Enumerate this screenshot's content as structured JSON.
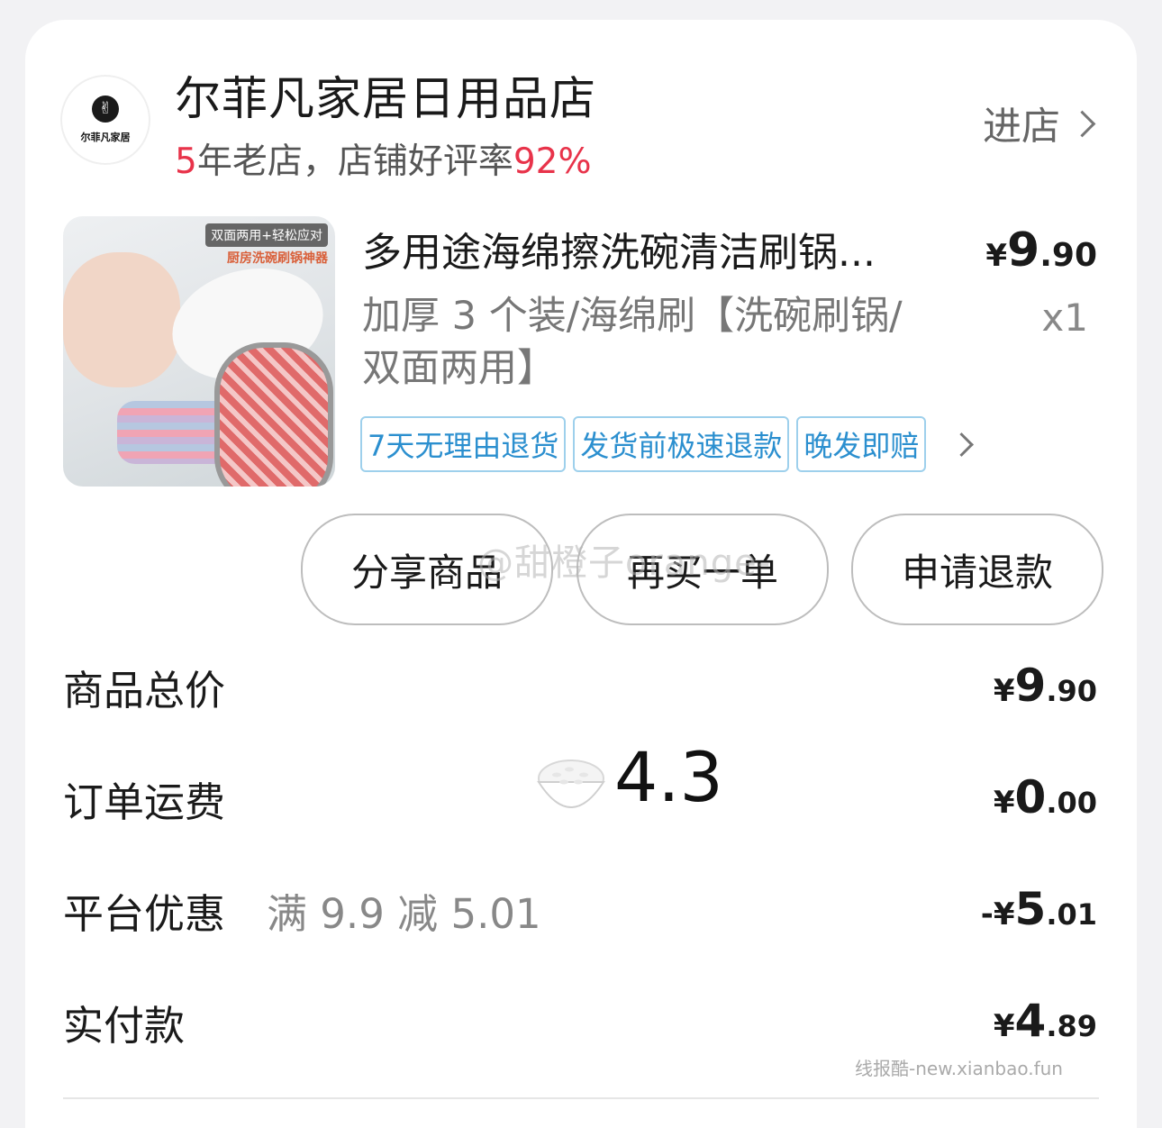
{
  "shop": {
    "name": "尔菲凡家居日用品店",
    "logo_text": "尔菲凡家居",
    "years": "5",
    "sub_middle": "年老店，店铺好评率",
    "rating": "92%",
    "enter_label": "进店"
  },
  "product": {
    "image_tag1": "双面两用+轻松应对",
    "image_tag2": "厨房洗碗刷锅神器",
    "title": "多用途海绵擦洗碗清洁刷锅...",
    "price_yen": "¥",
    "price_int": "9",
    "price_dec": ".90",
    "spec": "加厚 3 个装/海绵刷【洗碗刷锅/双面两用】",
    "qty": "x1",
    "service_tags": [
      "7天无理由退货",
      "发货前极速退款",
      "晚发即赔"
    ]
  },
  "actions": {
    "share": "分享商品",
    "rebuy": "再买一单",
    "refund": "申请退款"
  },
  "watermark": "@甜橙子orange-",
  "rating_overlay": "4.3",
  "summary": {
    "total_label": "商品总价",
    "total_yen": "¥",
    "total_int": "9",
    "total_dec": ".90",
    "shipping_label": "订单运费",
    "shipping_yen": "¥",
    "shipping_int": "0",
    "shipping_dec": ".00",
    "discount_label": "平台优惠",
    "discount_note": "满 9.9 减 5.01",
    "discount_prefix": "-¥",
    "discount_int": "5",
    "discount_dec": ".01",
    "paid_label": "实付款",
    "paid_yen": "¥",
    "paid_int": "4",
    "paid_dec": ".89"
  },
  "footer_watermark": "线报酷-new.xianbao.fun",
  "colors": {
    "accent_red": "#e8334a",
    "tag_blue": "#2b8fcf"
  }
}
